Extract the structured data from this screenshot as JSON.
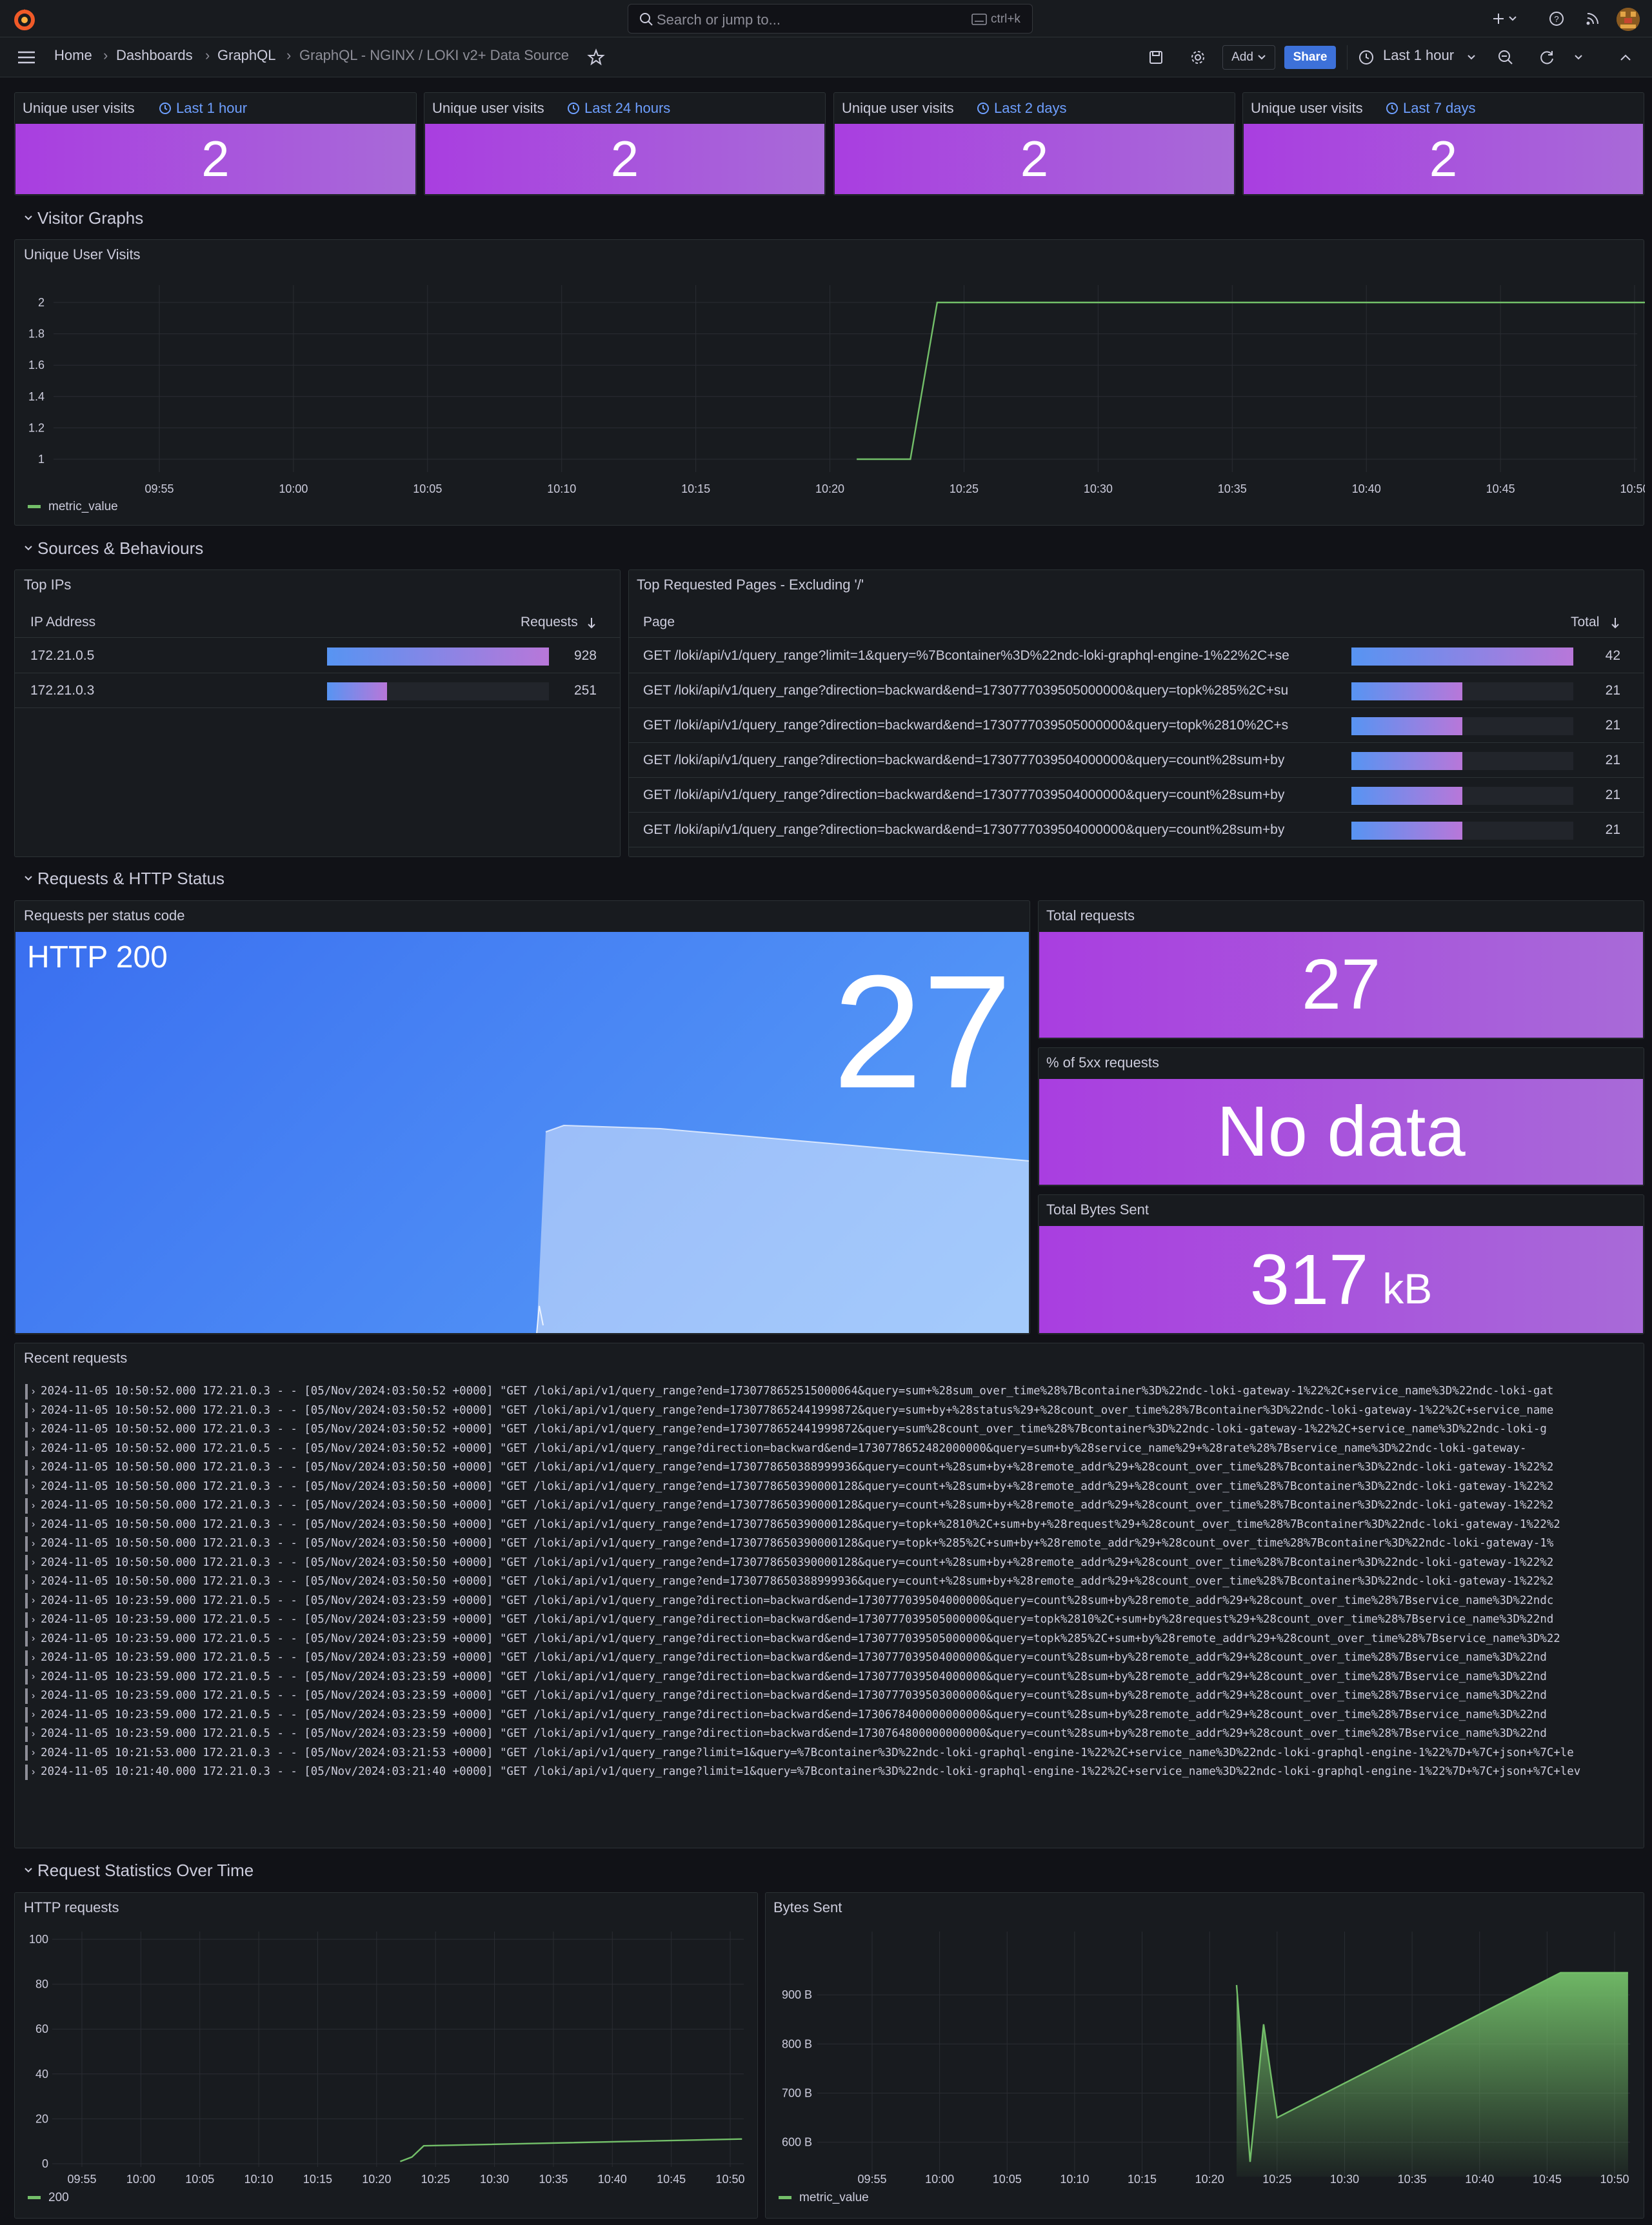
{
  "topbar": {
    "search_placeholder": "Search or jump to...",
    "search_shortcut": "ctrl+k"
  },
  "nav": {
    "breadcrumbs": [
      "Home",
      "Dashboards",
      "GraphQL",
      "GraphQL - NGINX / LOKI v2+ Data Source"
    ],
    "add_label": "Add",
    "share_label": "Share",
    "time_range": "Last 1 hour"
  },
  "stats_row": [
    {
      "title": "Unique user visits",
      "range": "Last 1 hour",
      "value": "2"
    },
    {
      "title": "Unique user visits",
      "range": "Last 24 hours",
      "value": "2"
    },
    {
      "title": "Unique user visits",
      "range": "Last 2 days",
      "value": "2"
    },
    {
      "title": "Unique user visits",
      "range": "Last 7 days",
      "value": "2"
    }
  ],
  "sections": {
    "visitor": "Visitor Graphs",
    "sources": "Sources & Behaviours",
    "requests": "Requests & HTTP Status",
    "stats": "Request Statistics Over Time"
  },
  "unique_visits_panel": {
    "title": "Unique User Visits"
  },
  "top_ips": {
    "title": "Top IPs",
    "col_ip": "IP Address",
    "col_requests": "Requests",
    "rows": [
      {
        "ip": "172.21.0.5",
        "value": 928,
        "value_text": "928"
      },
      {
        "ip": "172.21.0.3",
        "value": 251,
        "value_text": "251"
      }
    ],
    "max": 928
  },
  "top_pages": {
    "title": "Top Requested Pages - Excluding '/'",
    "col_page": "Page",
    "col_total": "Total",
    "rows": [
      {
        "page": "GET /loki/api/v1/query_range?limit=1&query=%7Bcontainer%3D%22ndc-loki-graphql-engine-1%22%2C+se",
        "value": 42,
        "value_text": "42"
      },
      {
        "page": "GET /loki/api/v1/query_range?direction=backward&end=1730777039505000000&query=topk%285%2C+su",
        "value": 21,
        "value_text": "21"
      },
      {
        "page": "GET /loki/api/v1/query_range?direction=backward&end=1730777039505000000&query=topk%2810%2C+s",
        "value": 21,
        "value_text": "21"
      },
      {
        "page": "GET /loki/api/v1/query_range?direction=backward&end=1730777039504000000&query=count%28sum+by",
        "value": 21,
        "value_text": "21"
      },
      {
        "page": "GET /loki/api/v1/query_range?direction=backward&end=1730777039504000000&query=count%28sum+by",
        "value": 21,
        "value_text": "21"
      },
      {
        "page": "GET /loki/api/v1/query_range?direction=backward&end=1730777039504000000&query=count%28sum+by",
        "value": 21,
        "value_text": "21"
      }
    ],
    "max": 42
  },
  "status_panel": {
    "title": "Requests per status code",
    "label": "HTTP 200",
    "value": "27"
  },
  "total_requests": {
    "title": "Total requests",
    "value": "27"
  },
  "pct_5xx": {
    "title": "% of 5xx requests",
    "value": "No data"
  },
  "bytes_sent_stat": {
    "title": "Total Bytes Sent",
    "value": "317",
    "unit": "kB"
  },
  "recent": {
    "title": "Recent requests",
    "lines": [
      "2024-11-05 10:50:52.000 172.21.0.3 - - [05/Nov/2024:03:50:52 +0000] \"GET /loki/api/v1/query_range?end=1730778652515000064&query=sum+%28sum_over_time%28%7Bcontainer%3D%22ndc-loki-gateway-1%22%2C+service_name%3D%22ndc-loki-gat",
      "2024-11-05 10:50:52.000 172.21.0.3 - - [05/Nov/2024:03:50:52 +0000] \"GET /loki/api/v1/query_range?end=1730778652441999872&query=sum+by+%28status%29+%28count_over_time%28%7Bcontainer%3D%22ndc-loki-gateway-1%22%2C+service_name",
      "2024-11-05 10:50:52.000 172.21.0.3 - - [05/Nov/2024:03:50:52 +0000] \"GET /loki/api/v1/query_range?end=1730778652441999872&query=sum%28count_over_time%28%7Bcontainer%3D%22ndc-loki-gateway-1%22%2C+service_name%3D%22ndc-loki-g",
      "2024-11-05 10:50:52.000 172.21.0.5 - - [05/Nov/2024:03:50:52 +0000] \"GET /loki/api/v1/query_range?direction=backward&end=1730778652482000000&query=sum+by%28service_name%29+%28rate%28%7Bservice_name%3D%22ndc-loki-gateway-",
      "2024-11-05 10:50:50.000 172.21.0.3 - - [05/Nov/2024:03:50:50 +0000] \"GET /loki/api/v1/query_range?end=1730778650388999936&query=count+%28sum+by+%28remote_addr%29+%28count_over_time%28%7Bcontainer%3D%22ndc-loki-gateway-1%22%2",
      "2024-11-05 10:50:50.000 172.21.0.3 - - [05/Nov/2024:03:50:50 +0000] \"GET /loki/api/v1/query_range?end=1730778650390000128&query=count+%28sum+by+%28remote_addr%29+%28count_over_time%28%7Bcontainer%3D%22ndc-loki-gateway-1%22%2",
      "2024-11-05 10:50:50.000 172.21.0.3 - - [05/Nov/2024:03:50:50 +0000] \"GET /loki/api/v1/query_range?end=1730778650390000128&query=count+%28sum+by+%28remote_addr%29+%28count_over_time%28%7Bcontainer%3D%22ndc-loki-gateway-1%22%2",
      "2024-11-05 10:50:50.000 172.21.0.3 - - [05/Nov/2024:03:50:50 +0000] \"GET /loki/api/v1/query_range?end=1730778650390000128&query=topk+%2810%2C+sum+by+%28request%29+%28count_over_time%28%7Bcontainer%3D%22ndc-loki-gateway-1%22%2",
      "2024-11-05 10:50:50.000 172.21.0.3 - - [05/Nov/2024:03:50:50 +0000] \"GET /loki/api/v1/query_range?end=1730778650390000128&query=topk+%285%2C+sum+by+%28remote_addr%29+%28count_over_time%28%7Bcontainer%3D%22ndc-loki-gateway-1%",
      "2024-11-05 10:50:50.000 172.21.0.3 - - [05/Nov/2024:03:50:50 +0000] \"GET /loki/api/v1/query_range?end=1730778650390000128&query=count+%28sum+by+%28remote_addr%29+%28count_over_time%28%7Bcontainer%3D%22ndc-loki-gateway-1%22%2",
      "2024-11-05 10:50:50.000 172.21.0.3 - - [05/Nov/2024:03:50:50 +0000] \"GET /loki/api/v1/query_range?end=1730778650388999936&query=count+%28sum+by+%28remote_addr%29+%28count_over_time%28%7Bcontainer%3D%22ndc-loki-gateway-1%22%2",
      "2024-11-05 10:23:59.000 172.21.0.5 - - [05/Nov/2024:03:23:59 +0000] \"GET /loki/api/v1/query_range?direction=backward&end=1730777039504000000&query=count%28sum+by%28remote_addr%29+%28count_over_time%28%7Bservice_name%3D%22ndc",
      "2024-11-05 10:23:59.000 172.21.0.5 - - [05/Nov/2024:03:23:59 +0000] \"GET /loki/api/v1/query_range?direction=backward&end=1730777039505000000&query=topk%2810%2C+sum+by%28request%29+%28count_over_time%28%7Bservice_name%3D%22nd",
      "2024-11-05 10:23:59.000 172.21.0.5 - - [05/Nov/2024:03:23:59 +0000] \"GET /loki/api/v1/query_range?direction=backward&end=1730777039505000000&query=topk%285%2C+sum+by%28remote_addr%29+%28count_over_time%28%7Bservice_name%3D%22",
      "2024-11-05 10:23:59.000 172.21.0.5 - - [05/Nov/2024:03:23:59 +0000] \"GET /loki/api/v1/query_range?direction=backward&end=1730777039504000000&query=count%28sum+by%28remote_addr%29+%28count_over_time%28%7Bservice_name%3D%22nd",
      "2024-11-05 10:23:59.000 172.21.0.5 - - [05/Nov/2024:03:23:59 +0000] \"GET /loki/api/v1/query_range?direction=backward&end=1730777039504000000&query=count%28sum+by%28remote_addr%29+%28count_over_time%28%7Bservice_name%3D%22nd",
      "2024-11-05 10:23:59.000 172.21.0.5 - - [05/Nov/2024:03:23:59 +0000] \"GET /loki/api/v1/query_range?direction=backward&end=1730777039503000000&query=count%28sum+by%28remote_addr%29+%28count_over_time%28%7Bservice_name%3D%22nd",
      "2024-11-05 10:23:59.000 172.21.0.5 - - [05/Nov/2024:03:23:59 +0000] \"GET /loki/api/v1/query_range?direction=backward&end=1730678400000000000&query=count%28sum+by%28remote_addr%29+%28count_over_time%28%7Bservice_name%3D%22nd",
      "2024-11-05 10:23:59.000 172.21.0.5 - - [05/Nov/2024:03:23:59 +0000] \"GET /loki/api/v1/query_range?direction=backward&end=1730764800000000000&query=count%28sum+by%28remote_addr%29+%28count_over_time%28%7Bservice_name%3D%22nd",
      "2024-11-05 10:21:53.000 172.21.0.3 - - [05/Nov/2024:03:21:53 +0000] \"GET /loki/api/v1/query_range?limit=1&query=%7Bcontainer%3D%22ndc-loki-graphql-engine-1%22%2C+service_name%3D%22ndc-loki-graphql-engine-1%22%7D+%7C+json+%7C+le",
      "2024-11-05 10:21:40.000 172.21.0.3 - - [05/Nov/2024:03:21:40 +0000] \"GET /loki/api/v1/query_range?limit=1&query=%7Bcontainer%3D%22ndc-loki-graphql-engine-1%22%2C+service_name%3D%22ndc-loki-graphql-engine-1%22%7D+%7C+json+%7C+lev"
    ]
  },
  "http_requests_panel": {
    "title": "HTTP requests"
  },
  "bytes_sent_panel": {
    "title": "Bytes Sent"
  },
  "colors": {
    "accent_blue": "#3d71d9",
    "stat_purple": "#a93ee0",
    "series_green": "#73bf69"
  },
  "chart_data": [
    {
      "type": "line",
      "title": "Unique User Visits",
      "x_ticks": [
        "09:55",
        "10:00",
        "10:05",
        "10:10",
        "10:15",
        "10:20",
        "10:25",
        "10:30",
        "10:35",
        "10:40",
        "10:45",
        "10:50"
      ],
      "y_ticks": [
        "1",
        "1.2",
        "1.4",
        "1.6",
        "1.8",
        "2"
      ],
      "ylim": [
        1,
        2
      ],
      "series": [
        {
          "name": "metric_value",
          "x": [
            "10:21",
            "10:23",
            "10:24",
            "10:51"
          ],
          "values": [
            1,
            1,
            2,
            2
          ]
        }
      ],
      "legend": "bottom-left"
    },
    {
      "type": "line",
      "title": "HTTP requests",
      "x_ticks": [
        "09:55",
        "10:00",
        "10:05",
        "10:10",
        "10:15",
        "10:20",
        "10:25",
        "10:30",
        "10:35",
        "10:40",
        "10:45",
        "10:50"
      ],
      "y_ticks": [
        "0",
        "20",
        "40",
        "60",
        "80",
        "100"
      ],
      "ylim": [
        0,
        100
      ],
      "series": [
        {
          "name": "200",
          "x": [
            "10:22",
            "10:23",
            "10:24",
            "10:51"
          ],
          "values": [
            1,
            3,
            8,
            11
          ]
        }
      ],
      "legend": "bottom-left"
    },
    {
      "type": "area",
      "title": "Bytes Sent",
      "x_ticks": [
        "09:55",
        "10:00",
        "10:05",
        "10:10",
        "10:15",
        "10:20",
        "10:25",
        "10:30",
        "10:35",
        "10:40",
        "10:45",
        "10:50"
      ],
      "y_ticks": [
        "600 B",
        "700 B",
        "800 B",
        "900 B"
      ],
      "ylim": [
        530,
        950
      ],
      "series": [
        {
          "name": "metric_value",
          "x": [
            "10:22",
            "10:23",
            "10:24",
            "10:25",
            "10:46",
            "10:51"
          ],
          "values": [
            920,
            560,
            840,
            650,
            945,
            945
          ]
        }
      ],
      "legend": "bottom-left"
    }
  ]
}
